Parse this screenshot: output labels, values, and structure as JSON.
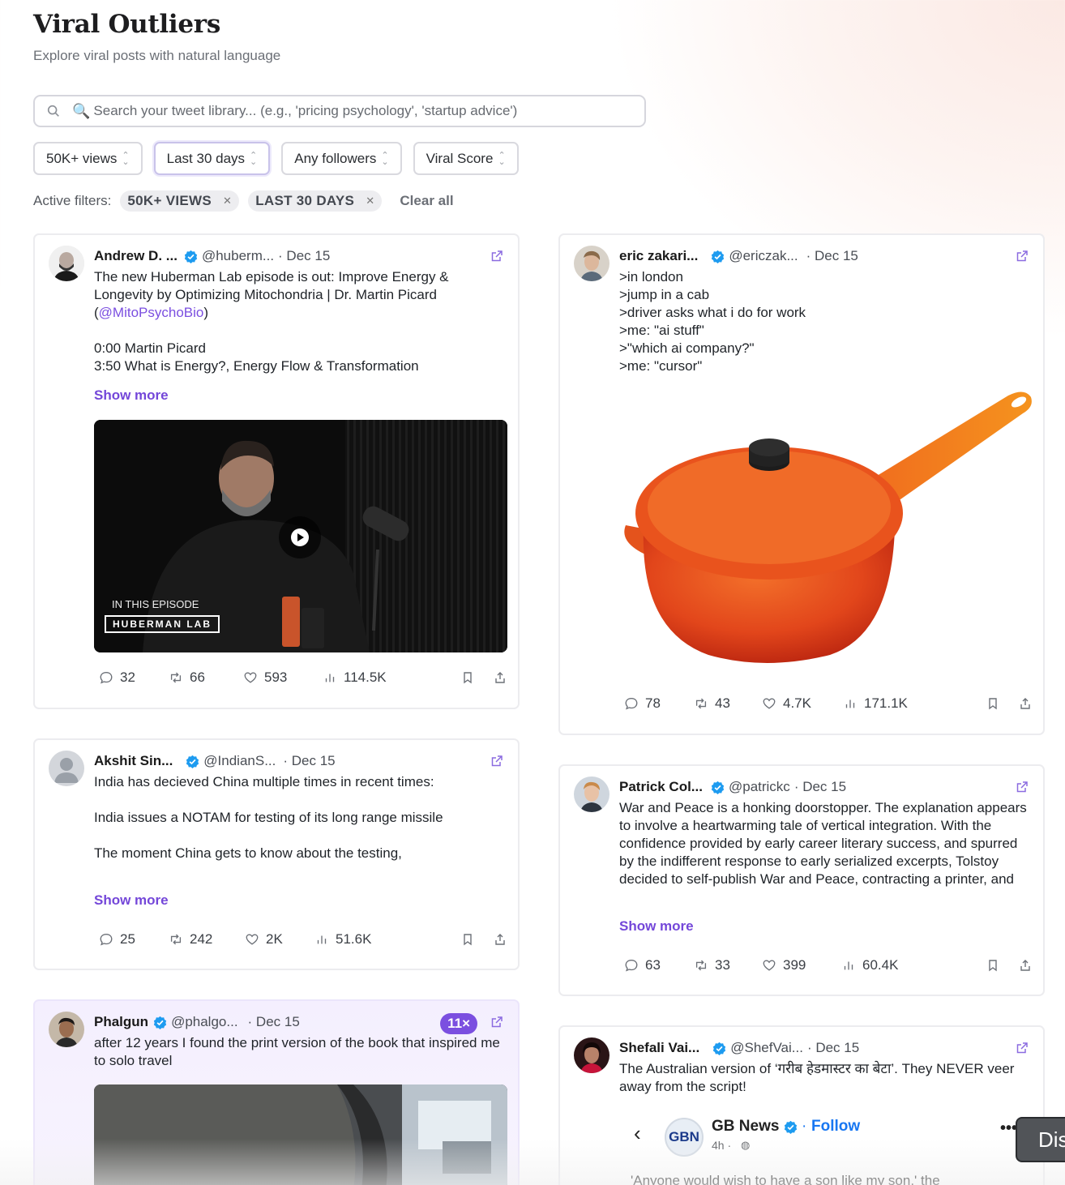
{
  "header": {
    "title": "Viral Outliers",
    "subtitle": "Explore viral posts with natural language"
  },
  "search": {
    "placeholder": "Search your tweet library... (e.g., 'pricing psychology', 'startup advice')",
    "emoji": "🔍"
  },
  "filters": {
    "views": "50K+ views",
    "range": "Last 30 days",
    "followers": "Any followers",
    "sort": "Viral Score"
  },
  "active_filters": {
    "label": "Active filters:",
    "chips": [
      "50K+ VIEWS",
      "LAST 30 DAYS"
    ],
    "clear_label": "Clear all"
  },
  "posts": [
    {
      "name": "Andrew D. ...",
      "handle": "@huberm...",
      "date": "· Dec 15",
      "text_before": "The new Huberman Lab episode is out: Improve Energy & Longevity by Optimizing Mitochondria | Dr. Martin Picard\n(",
      "mention": "@MitoPsychoBio",
      "text_after": ")\n\n0:00 Martin Picard\n3:50 What is Energy?, Energy Flow & Transformation",
      "show_more": "Show more",
      "media_caption": "IN THIS EPISODE",
      "media_brand": "HUBERMAN LAB",
      "stats": {
        "replies": "32",
        "retweets": "66",
        "likes": "593",
        "views": "114.5K"
      }
    },
    {
      "name": "eric zakari...",
      "handle": "@ericzak...",
      "date": "· Dec 15",
      "text": ">in london\n>jump in a cab\n>driver asks what i do for work\n>me: \"ai stuff\"\n>\"which ai company?\"\n>me: \"cursor\"",
      "stats": {
        "replies": "78",
        "retweets": "43",
        "likes": "4.7K",
        "views": "171.1K"
      }
    },
    {
      "name": "Akshit Sin...",
      "handle": "@IndianS...",
      "date": "· Dec 15",
      "text": "India has decieved China multiple times in recent times:\n\nIndia issues a NOTAM for testing of its long range missile\n\nThe moment China gets to know about the testing,",
      "show_more": "Show more",
      "stats": {
        "replies": "25",
        "retweets": "242",
        "likes": "2K",
        "views": "51.6K"
      }
    },
    {
      "name": "Patrick Col...",
      "handle": "@patrickc",
      "date": "· Dec 15",
      "text": "War and Peace is a honking doorstopper. The explanation appears to involve a heartwarming tale of vertical integration. With the confidence provided by early career literary success, and spurred by the indifferent response to early serialized excerpts, Tolstoy decided to self-publish War and Peace, contracting a printer, and",
      "show_more": "Show more",
      "stats": {
        "replies": "63",
        "retweets": "33",
        "likes": "399",
        "views": "60.4K"
      }
    },
    {
      "name": "Phalgun",
      "handle": "@phalgo...",
      "date": "· Dec 15",
      "multiplier": "11×",
      "text": "after 12 years I found the print version of the book that inspired me to solo travel"
    },
    {
      "name": "Shefali Vai...",
      "handle": "@ShefVai...",
      "date": "· Dec 15",
      "text": "The Australian version of ‘गरीब हेडमास्टर का बेटा’. They NEVER veer away from the script!",
      "embed": {
        "source": "GB News",
        "follow": "Follow",
        "time": "4h ·",
        "quote": "'Anyone would wish to have a son like my son,' the"
      }
    }
  ],
  "overlay_button": "Dis",
  "colors": {
    "accent": "#7447d9",
    "verified": "#1d9bf0",
    "highlight_bg": "#f4effe"
  }
}
